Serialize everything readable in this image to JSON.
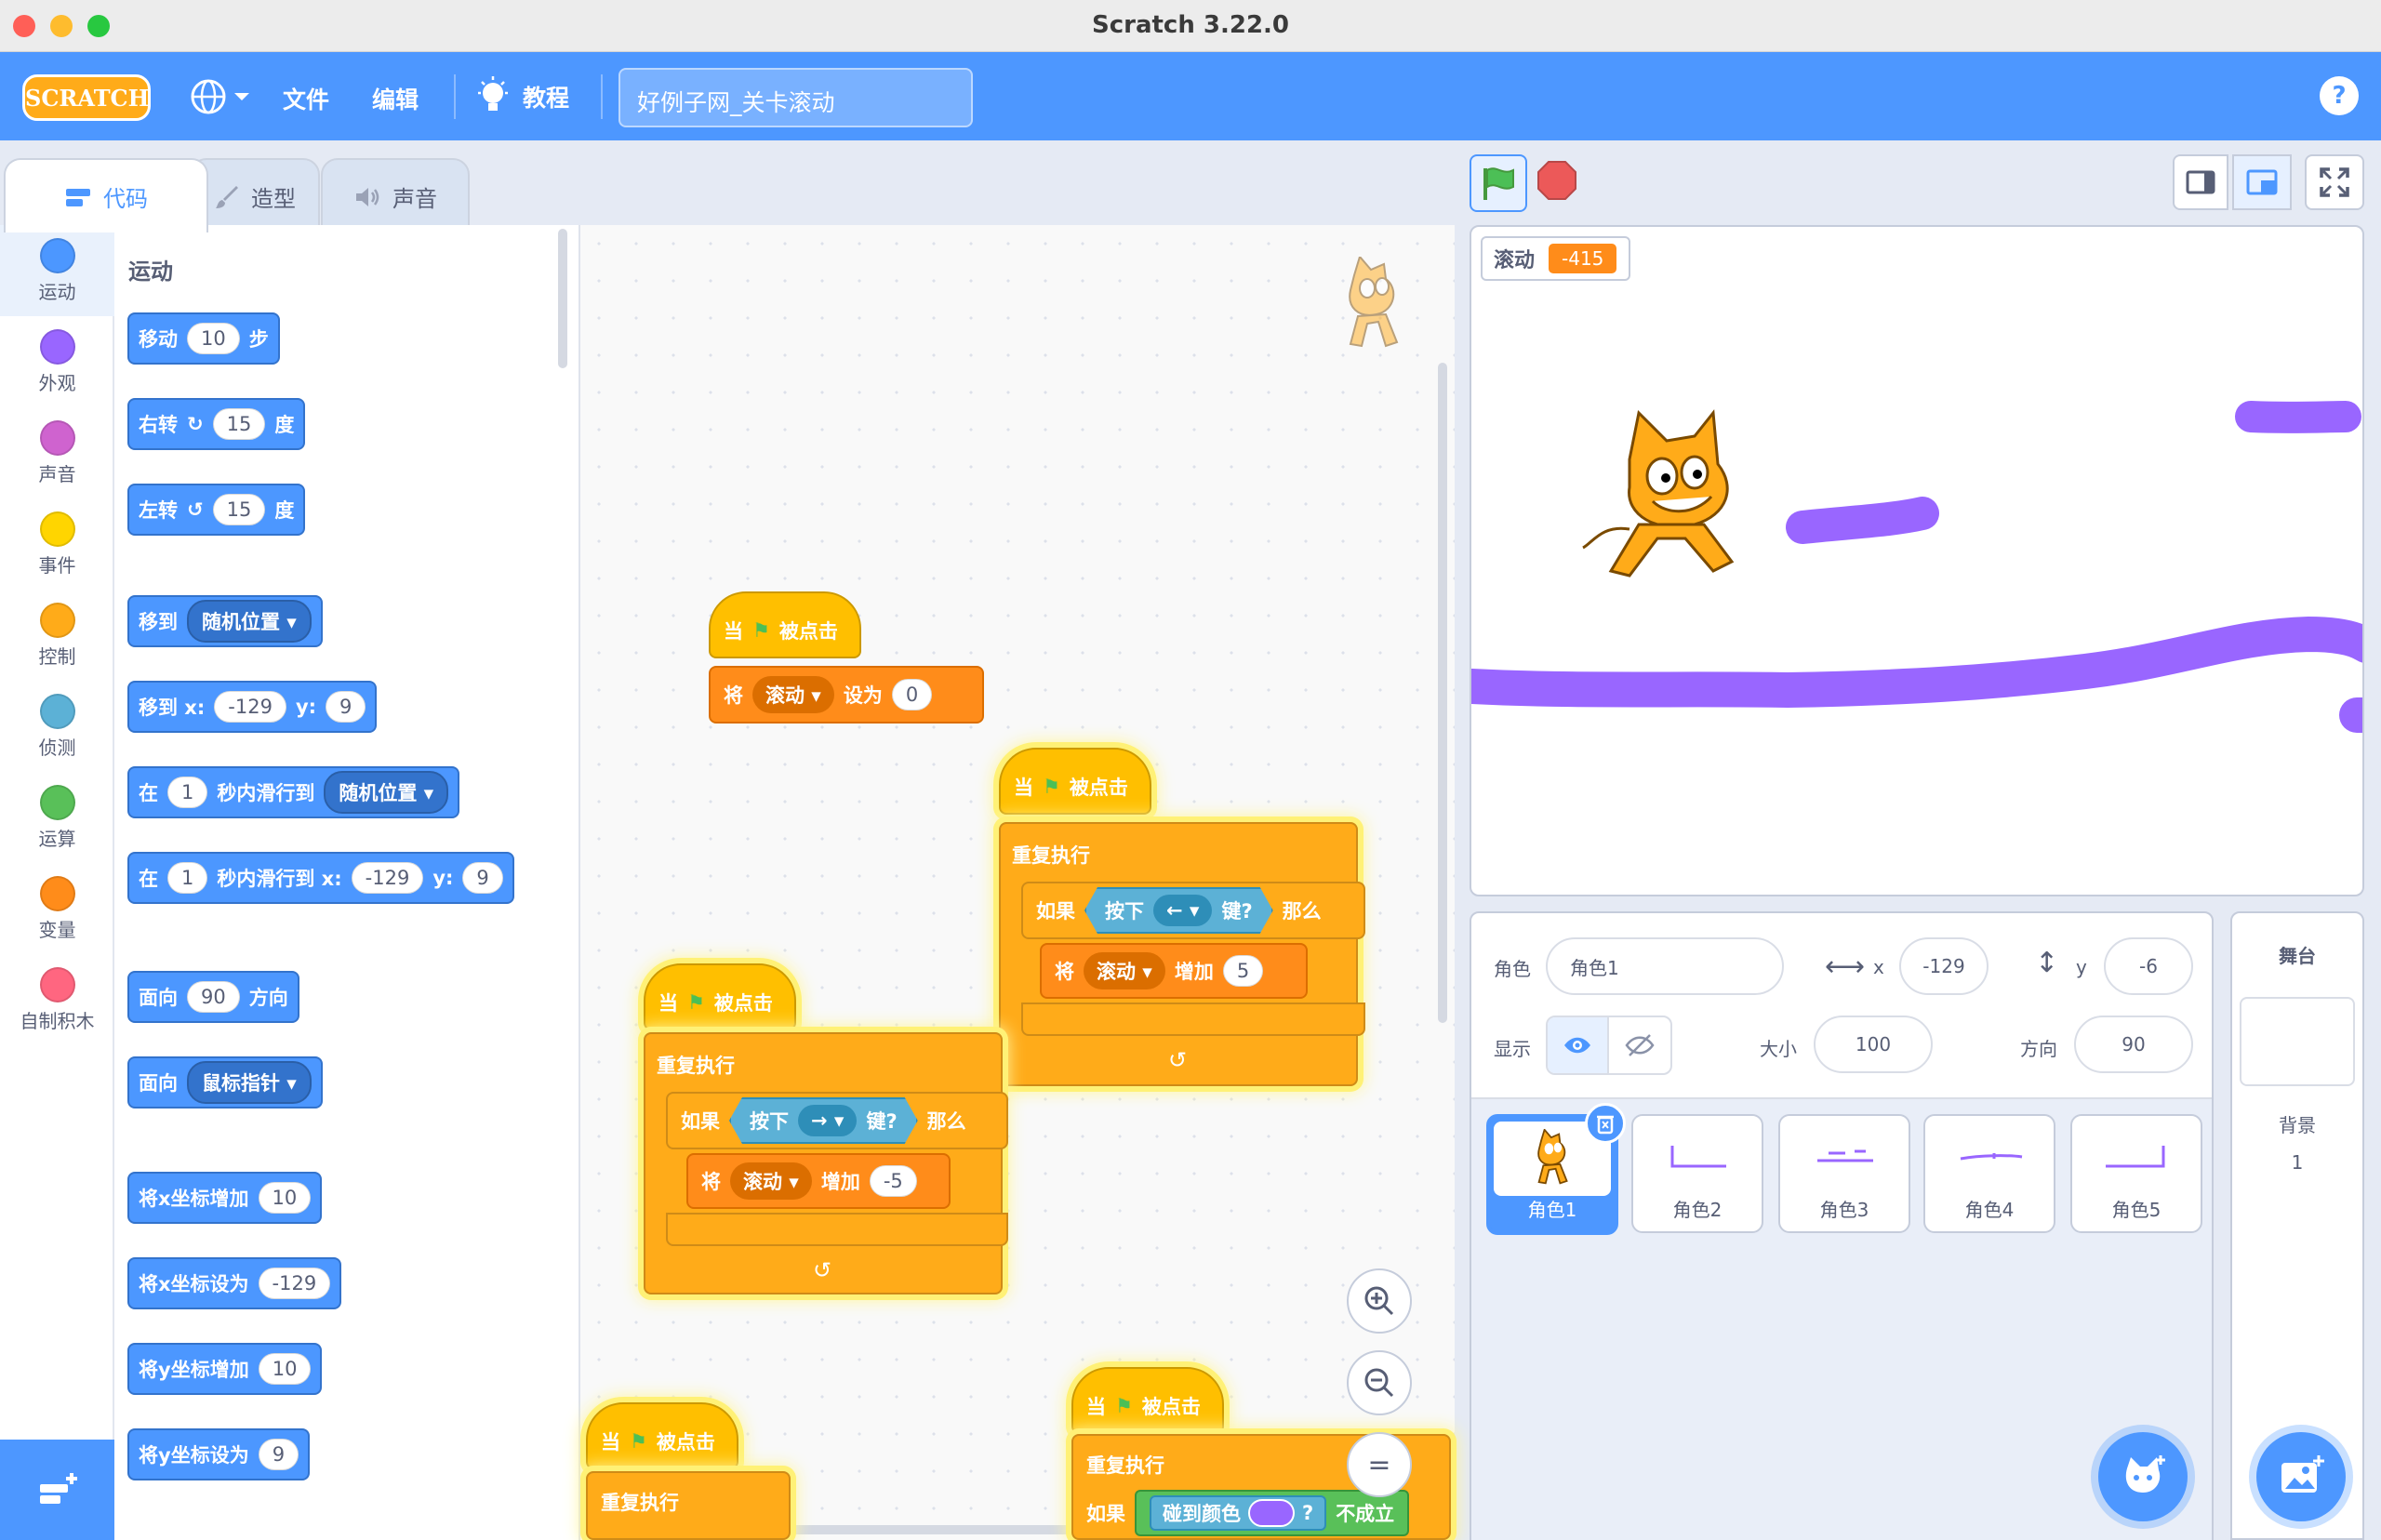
{
  "window": {
    "title": "Scratch 3.22.0"
  },
  "menu": {
    "logo": "SCRATCH",
    "file": "文件",
    "edit": "编辑",
    "tutorials": "教程",
    "project_title": "好例子网_关卡滚动",
    "help": "?"
  },
  "tabs": {
    "code": "代码",
    "costumes": "造型",
    "sounds": "声音"
  },
  "categories": [
    {
      "label": "运动",
      "color": "#4c97ff"
    },
    {
      "label": "外观",
      "color": "#9966ff"
    },
    {
      "label": "声音",
      "color": "#cf63cf"
    },
    {
      "label": "事件",
      "color": "#ffd500"
    },
    {
      "label": "控制",
      "color": "#ffab19"
    },
    {
      "label": "侦测",
      "color": "#5cb1d6"
    },
    {
      "label": "运算",
      "color": "#59c059"
    },
    {
      "label": "变量",
      "color": "#ff8c1a"
    },
    {
      "label": "自制积木",
      "color": "#ff6680"
    }
  ],
  "palette": {
    "heading": "运动",
    "move": {
      "a": "移动",
      "v": "10",
      "b": "步"
    },
    "turn_right": {
      "a": "右转",
      "v": "15",
      "b": "度"
    },
    "turn_left": {
      "a": "左转",
      "v": "15",
      "b": "度"
    },
    "goto": {
      "a": "移到",
      "d": "随机位置"
    },
    "goto_xy": {
      "a": "移到 x:",
      "x": "-129",
      "b": "y:",
      "y": "9"
    },
    "glide": {
      "a": "在",
      "v": "1",
      "b": "秒内滑行到",
      "d": "随机位置"
    },
    "glide_xy": {
      "a": "在",
      "v": "1",
      "b": "秒内滑行到 x:",
      "x": "-129",
      "c": "y:",
      "y": "9"
    },
    "point_dir": {
      "a": "面向",
      "v": "90",
      "b": "方向"
    },
    "point_towards": {
      "a": "面向",
      "d": "鼠标指针"
    },
    "change_x": {
      "a": "将x坐标增加",
      "v": "10"
    },
    "set_x": {
      "a": "将x坐标设为",
      "v": "-129"
    },
    "change_y": {
      "a": "将y坐标增加",
      "v": "10"
    },
    "set_y": {
      "a": "将y坐标设为",
      "v": "9"
    }
  },
  "scripts": {
    "when": "当",
    "clicked": "被点击",
    "set": "将",
    "to": "设为",
    "forever": "重复执行",
    "if": "如果",
    "then": "那么",
    "key": "按下",
    "pressed": "键?",
    "change": "增加",
    "var": "滚动",
    "s1_value": "0",
    "left_arrow": "←",
    "right_arrow": "→",
    "s2_value": "5",
    "s3_value": "-5",
    "touching": "碰到颜色",
    "q": "?",
    "not": "不成立"
  },
  "zoom": {
    "in": "+",
    "out": "−",
    "reset": "="
  },
  "stage": {
    "monitor_label": "滚动",
    "monitor_value": "-415"
  },
  "sprite_info": {
    "sprite_label": "角色",
    "sprite_name": "角色1",
    "x_label": "x",
    "x": "-129",
    "y_label": "y",
    "y": "-6",
    "show_label": "显示",
    "size_label": "大小",
    "size": "100",
    "direction_label": "方向",
    "direction": "90"
  },
  "sprites": [
    {
      "name": "角色1"
    },
    {
      "name": "角色2"
    },
    {
      "name": "角色3"
    },
    {
      "name": "角色4"
    },
    {
      "name": "角色5"
    }
  ],
  "stage_panel": {
    "title": "舞台",
    "backdrop_label": "背景",
    "backdrop_count": "1"
  }
}
